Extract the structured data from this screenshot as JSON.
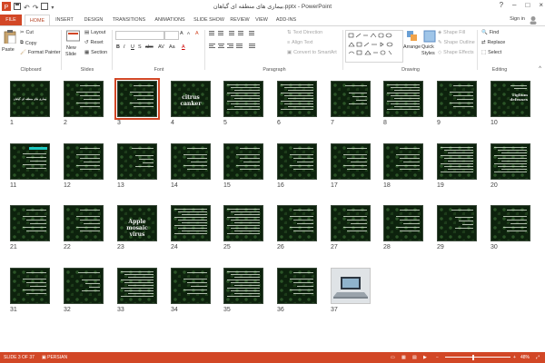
{
  "window": {
    "title": "بیماری های منطقه ای گیاهان.pptx - PowerPoint",
    "controls": [
      "?",
      "–",
      "□",
      "×"
    ]
  },
  "tabs": [
    "FILE",
    "HOME",
    "INSERT",
    "DESIGN",
    "TRANSITIONS",
    "ANIMATIONS",
    "SLIDE SHOW",
    "REVIEW",
    "VIEW",
    "ADD-INS"
  ],
  "sign_in": "Sign in",
  "ribbon": {
    "clipboard": {
      "paste": "Paste",
      "cut": "Cut",
      "copy": "Copy",
      "format_painter": "Format Painter",
      "label": "Clipboard"
    },
    "slides": {
      "new_slide": "New",
      "new_slide2": "Slide",
      "layout": "Layout",
      "reset": "Reset",
      "section": "Section",
      "label": "Slides"
    },
    "font": {
      "label": "Font",
      "bold": "B",
      "italic": "I",
      "underline": "U",
      "strike": "S",
      "abc": "abc",
      "av": "AV",
      "aa": "Aa",
      "grow": "A",
      "shrink": "A",
      "clear": "A",
      "color": "A"
    },
    "paragraph": {
      "text_direction": "Text Direction",
      "align_text": "Align Text",
      "smartart": "Convert to SmartArt",
      "label": "Paragraph"
    },
    "drawing": {
      "arrange": "Arrange",
      "quick_styles": "Quick",
      "quick_styles2": "Styles",
      "shape_fill": "Shape Fill",
      "shape_outline": "Shape Outline",
      "shape_effects": "Shape Effects",
      "label": "Drawing"
    },
    "editing": {
      "find": "Find",
      "replace": "Replace",
      "select": "Select",
      "label": "Editing"
    }
  },
  "slides": [
    {
      "n": "1",
      "kind": "title",
      "text": "بیماری های منطقه ای گیاهان"
    },
    {
      "n": "2",
      "kind": "text"
    },
    {
      "n": "3",
      "kind": "text",
      "selected": true
    },
    {
      "n": "4",
      "kind": "big",
      "text": "citrus canker"
    },
    {
      "n": "5",
      "kind": "dense"
    },
    {
      "n": "6",
      "kind": "dense"
    },
    {
      "n": "7",
      "kind": "heading"
    },
    {
      "n": "8",
      "kind": "dense"
    },
    {
      "n": "9",
      "kind": "text"
    },
    {
      "n": "10",
      "kind": "bigsmall",
      "text": "Tiglium defenses"
    },
    {
      "n": "11",
      "kind": "highlight"
    },
    {
      "n": "12",
      "kind": "text"
    },
    {
      "n": "13",
      "kind": "heading"
    },
    {
      "n": "14",
      "kind": "text"
    },
    {
      "n": "15",
      "kind": "text"
    },
    {
      "n": "16",
      "kind": "text"
    },
    {
      "n": "17",
      "kind": "text"
    },
    {
      "n": "18",
      "kind": "text"
    },
    {
      "n": "19",
      "kind": "dense"
    },
    {
      "n": "20",
      "kind": "dense"
    },
    {
      "n": "21",
      "kind": "text"
    },
    {
      "n": "22",
      "kind": "text"
    },
    {
      "n": "23",
      "kind": "big",
      "text": "Apple mosaic virus"
    },
    {
      "n": "24",
      "kind": "dense"
    },
    {
      "n": "25",
      "kind": "dense"
    },
    {
      "n": "26",
      "kind": "text"
    },
    {
      "n": "27",
      "kind": "text"
    },
    {
      "n": "28",
      "kind": "text"
    },
    {
      "n": "29",
      "kind": "heading"
    },
    {
      "n": "30",
      "kind": "text"
    },
    {
      "n": "31",
      "kind": "text"
    },
    {
      "n": "32",
      "kind": "heading"
    },
    {
      "n": "33",
      "kind": "dense"
    },
    {
      "n": "34",
      "kind": "text"
    },
    {
      "n": "35",
      "kind": "dense"
    },
    {
      "n": "36",
      "kind": "text"
    },
    {
      "n": "37",
      "kind": "photo"
    }
  ],
  "status": {
    "slide_of": "SLIDE 3 OF 37",
    "language": "PERSIAN",
    "zoom": "48%"
  },
  "colors": {
    "accent": "#d24726",
    "slide_bg": "#0d220d"
  }
}
